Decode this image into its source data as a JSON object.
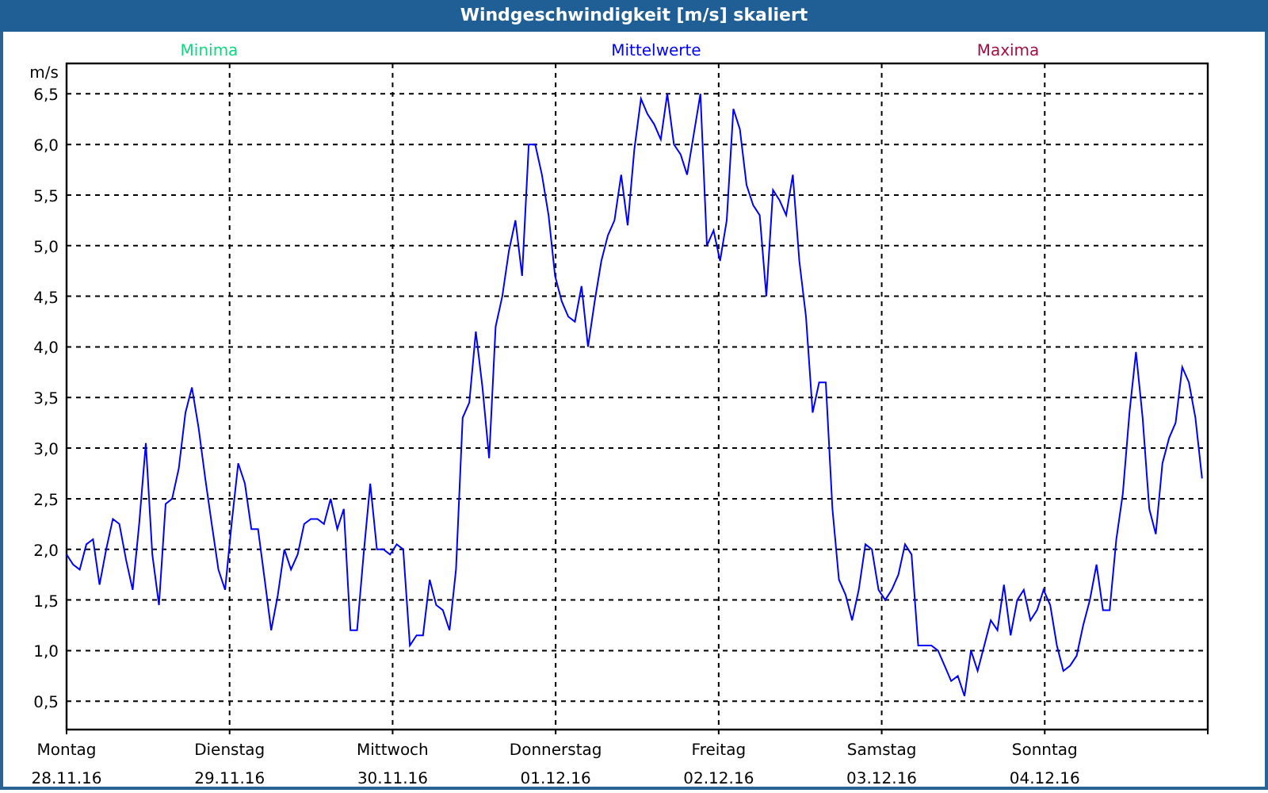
{
  "window": {
    "title": "Windgeschwindigkeit [m/s] skaliert"
  },
  "legend": [
    {
      "name": "Minima",
      "color": "#10d880"
    },
    {
      "name": "Mittelwerte",
      "color": "#0000ff"
    },
    {
      "name": "Maxima",
      "color": "#a01040"
    }
  ],
  "days": [
    {
      "day": "Montag",
      "date": "28.11.16"
    },
    {
      "day": "Dienstag",
      "date": "29.11.16"
    },
    {
      "day": "Mittwoch",
      "date": "30.11.16"
    },
    {
      "day": "Donnerstag",
      "date": "01.12.16"
    },
    {
      "day": "Freitag",
      "date": "02.12.16"
    },
    {
      "day": "Samstag",
      "date": "03.12.16"
    },
    {
      "day": "Sonntag",
      "date": "04.12.16"
    }
  ],
  "chart_data": {
    "type": "line",
    "ylabel": "m/s",
    "grid": true,
    "ylim": [
      0.22,
      6.8
    ],
    "yticks": [
      {
        "value": 0.5,
        "label": "0,5"
      },
      {
        "value": 1,
        "label": "1,0"
      },
      {
        "value": 1.5,
        "label": "1,5"
      },
      {
        "value": 2,
        "label": "2,0"
      },
      {
        "value": 2.5,
        "label": "2,5"
      },
      {
        "value": 3,
        "label": "3,0"
      },
      {
        "value": 3.5,
        "label": "3,5"
      },
      {
        "value": 4,
        "label": "4,0"
      },
      {
        "value": 4.5,
        "label": "4,5"
      },
      {
        "value": 5,
        "label": "5,0"
      },
      {
        "value": 5.5,
        "label": "5,5"
      },
      {
        "value": 6,
        "label": "6,0"
      },
      {
        "value": 6.5,
        "label": "6,5"
      }
    ],
    "series": [
      {
        "color": "#0000ff",
        "values": [
          1.95,
          1.85,
          1.8,
          2.05,
          2.1,
          1.65,
          2.0,
          2.3,
          2.25,
          1.9,
          1.6,
          2.25,
          3.05,
          1.95,
          1.45,
          2.45,
          2.5,
          2.8,
          3.35,
          3.6,
          3.2,
          2.7,
          2.25,
          1.8,
          1.6,
          2.25,
          2.85,
          2.65,
          2.2,
          2.2,
          1.7,
          1.2,
          1.55,
          2.0,
          1.8,
          1.95,
          2.25,
          2.3,
          2.3,
          2.25,
          2.5,
          2.2,
          2.4,
          1.2,
          1.2,
          1.95,
          2.65,
          2.0,
          2.0,
          1.95,
          2.05,
          2.0,
          1.05,
          1.15,
          1.15,
          1.7,
          1.45,
          1.4,
          1.2,
          1.8,
          3.3,
          3.45,
          4.15,
          3.6,
          2.9,
          4.2,
          4.5,
          4.95,
          5.25,
          4.7,
          6.0,
          6.0,
          5.7,
          5.3,
          4.7,
          4.45,
          4.3,
          4.25,
          4.6,
          4.0,
          4.45,
          4.85,
          5.1,
          5.25,
          5.7,
          5.2,
          5.95,
          6.45,
          6.3,
          6.2,
          6.05,
          6.5,
          6.0,
          5.9,
          5.7,
          6.1,
          6.5,
          5.0,
          5.15,
          4.85,
          5.25,
          6.35,
          6.15,
          5.6,
          5.4,
          5.3,
          4.5,
          5.55,
          5.45,
          5.3,
          5.7,
          4.85,
          4.3,
          3.35,
          3.65,
          3.65,
          2.4,
          1.7,
          1.55,
          1.3,
          1.6,
          2.05,
          2.0,
          1.6,
          1.5,
          1.6,
          1.75,
          2.05,
          1.95,
          1.05,
          1.05,
          1.05,
          1.0,
          0.85,
          0.7,
          0.75,
          0.55,
          1.0,
          0.8,
          1.05,
          1.3,
          1.2,
          1.65,
          1.15,
          1.5,
          1.6,
          1.3,
          1.4,
          1.6,
          1.45,
          1.05,
          0.8,
          0.85,
          0.95,
          1.25,
          1.5,
          1.85,
          1.4,
          1.4,
          2.1,
          2.55,
          3.35,
          3.95,
          3.3,
          2.4,
          2.15,
          2.85,
          3.1,
          3.25,
          3.8,
          3.65,
          3.3,
          2.7
        ]
      }
    ]
  }
}
